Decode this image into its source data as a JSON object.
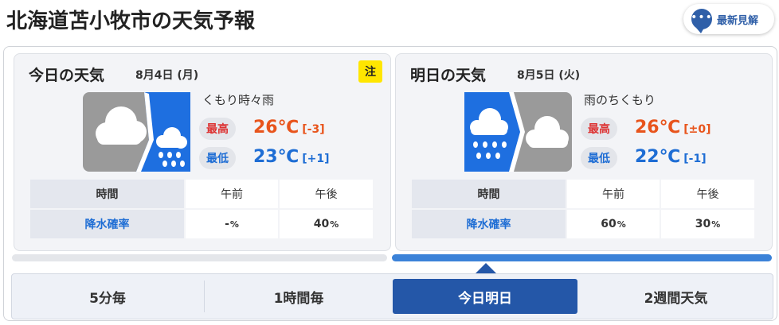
{
  "page": {
    "title": "北海道苫小牧市の天気予報",
    "newest_label": "最新見解",
    "newest_dots": "•••"
  },
  "today": {
    "day_label": "今日の天気",
    "date": "8月4日 (月)",
    "warning_badge": "注",
    "weather": "くもり時々雨",
    "icon": "cloudy-then-rain-icon",
    "high_label": "最高",
    "high_temp": "26℃",
    "high_diff": "[-3]",
    "low_label": "最低",
    "low_temp": "23℃",
    "low_diff": "[+1]",
    "table": {
      "time_header": "時間",
      "am_header": "午前",
      "pm_header": "午後",
      "precip_label": "降水確率",
      "am_value": "-",
      "pm_value": "40",
      "unit": "%"
    }
  },
  "tomorrow": {
    "day_label": "明日の天気",
    "date": "8月5日 (火)",
    "weather": "雨のちくもり",
    "icon": "rain-then-cloudy-icon",
    "high_label": "最高",
    "high_temp": "26℃",
    "high_diff": "[±0]",
    "low_label": "最低",
    "low_temp": "22℃",
    "low_diff": "[-1]",
    "table": {
      "time_header": "時間",
      "am_header": "午前",
      "pm_header": "午後",
      "precip_label": "降水確率",
      "am_value": "60",
      "pm_value": "30",
      "unit": "%"
    }
  },
  "tabs": [
    {
      "label": "5分毎",
      "selected": false
    },
    {
      "label": "1時間毎",
      "selected": false
    },
    {
      "label": "今日明日",
      "selected": true
    },
    {
      "label": "2週間天気",
      "selected": false
    }
  ],
  "colors": {
    "accent": "#2457a8",
    "high": "#e8541c",
    "low": "#1e6dd4",
    "warning": "#ffe600"
  }
}
